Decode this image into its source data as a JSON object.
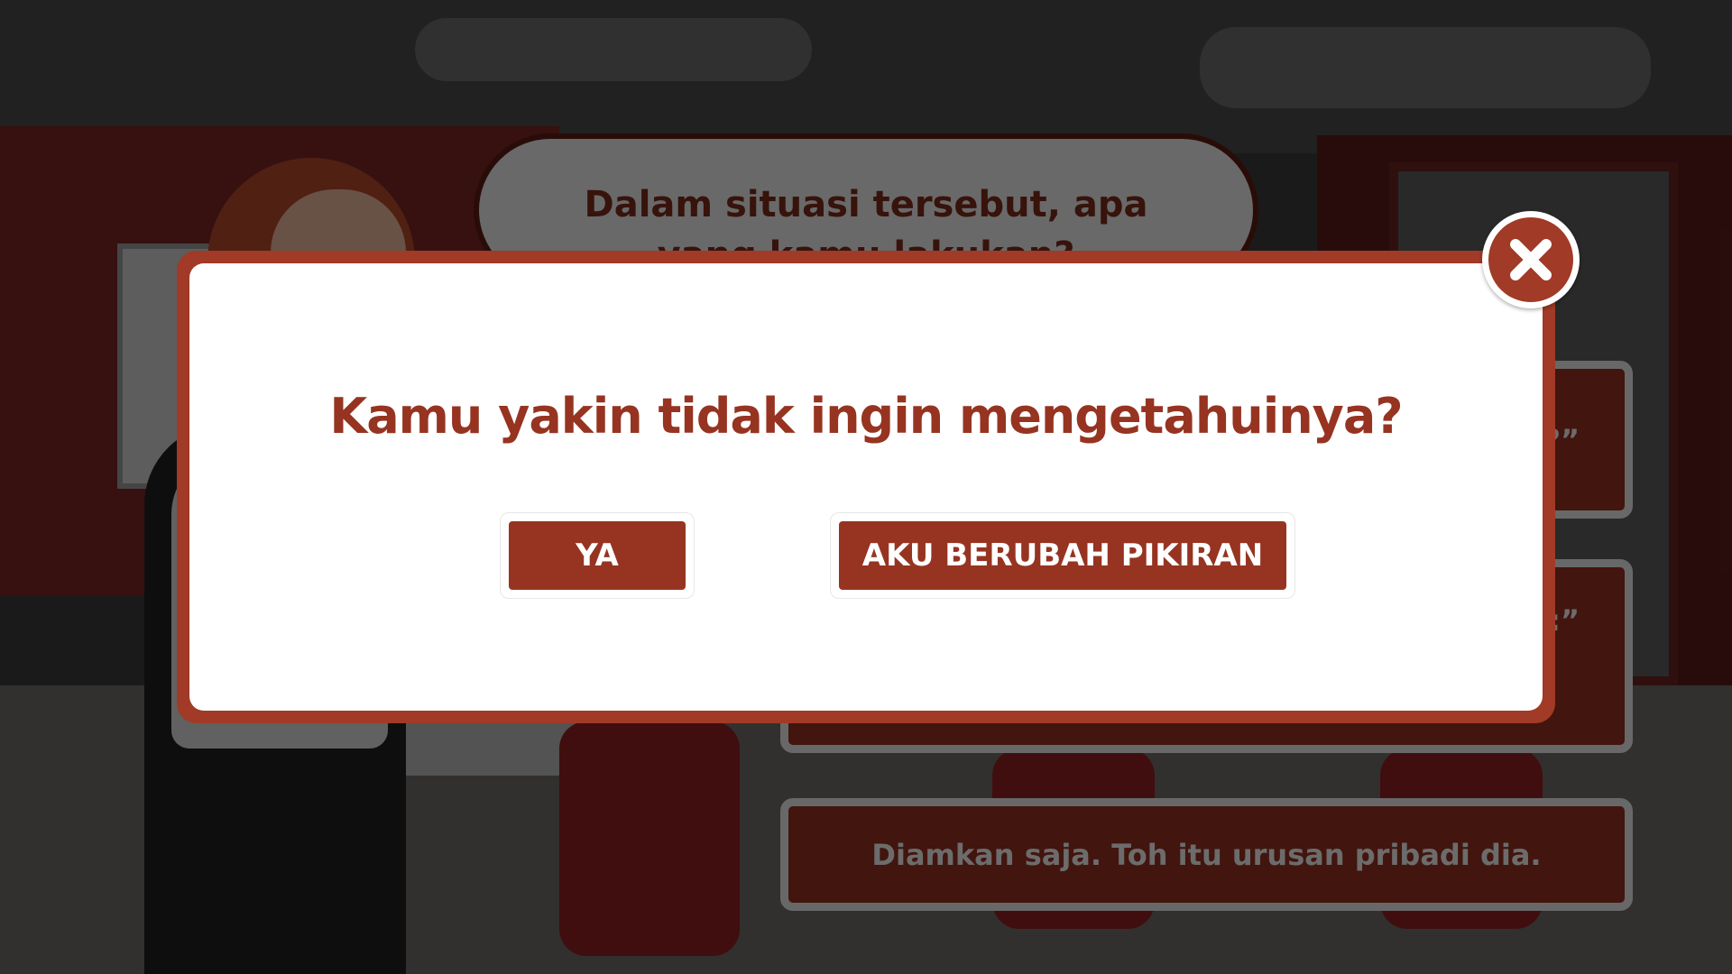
{
  "scene": {
    "question": "Dalam situasi tersebut, apa yang kamu lakukan?",
    "answers": [
      "“...?”",
      "“...:”",
      "Diamkan saja. Toh itu urusan pribadi dia."
    ]
  },
  "dialog": {
    "title": "Kamu yakin tidak ingin mengetahuinya?",
    "yes_label": "YA",
    "change_mind_label": "AKU BERUBAH PIKIRAN",
    "close_icon": "close-icon"
  },
  "colors": {
    "accent": "#963421",
    "frame": "#a13a26",
    "overlay": "rgba(0,0,0,0.55)"
  }
}
